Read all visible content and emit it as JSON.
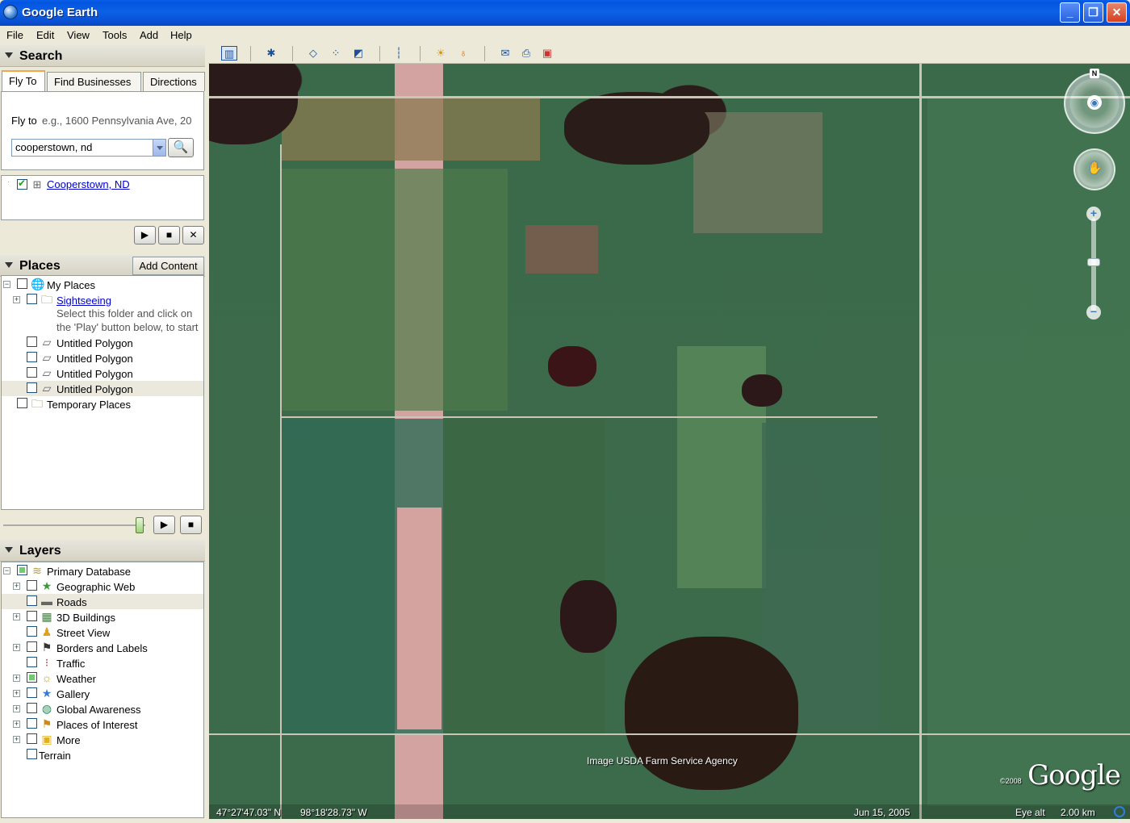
{
  "window": {
    "title": "Google Earth",
    "minimize": "_",
    "maximize": "❐",
    "close": "✕"
  },
  "menu": [
    "File",
    "Edit",
    "View",
    "Tools",
    "Add",
    "Help"
  ],
  "search": {
    "header": "Search",
    "tabs": [
      "Fly To",
      "Find Businesses",
      "Directions"
    ],
    "flyto_label": "Fly to",
    "flyto_hint": "e.g., 1600 Pennsylvania Ave, 20",
    "input_value": "cooperstown, nd",
    "result": "Cooperstown, ND"
  },
  "places": {
    "header": "Places",
    "add_content": "Add Content",
    "items": [
      {
        "label": "My Places"
      },
      {
        "label": "Sightseeing"
      },
      {
        "label": "Select this folder and click on"
      },
      {
        "label": "the 'Play' button below, to start"
      },
      {
        "label": "Untitled Polygon"
      },
      {
        "label": "Untitled Polygon"
      },
      {
        "label": "Untitled Polygon"
      },
      {
        "label": "Untitled Polygon"
      },
      {
        "label": "Temporary Places"
      }
    ]
  },
  "layers": {
    "header": "Layers",
    "items": [
      {
        "label": "Primary Database",
        "icon": "database-icon"
      },
      {
        "label": "Geographic Web",
        "icon": "star-icon"
      },
      {
        "label": "Roads",
        "icon": "road-icon"
      },
      {
        "label": "3D Buildings",
        "icon": "building-icon"
      },
      {
        "label": "Street View",
        "icon": "person-icon"
      },
      {
        "label": "Borders and Labels",
        "icon": "flag-icon"
      },
      {
        "label": "Traffic",
        "icon": "traffic-light-icon"
      },
      {
        "label": "Weather",
        "icon": "sun-icon"
      },
      {
        "label": "Gallery",
        "icon": "star-icon"
      },
      {
        "label": "Global Awareness",
        "icon": "globe-icon"
      },
      {
        "label": "Places of Interest",
        "icon": "flag-icon"
      },
      {
        "label": "More",
        "icon": "folder-icon"
      },
      {
        "label": "Terrain",
        "icon": ""
      }
    ]
  },
  "map": {
    "attribution": "Image USDA Farm Service Agency",
    "logo": "Google",
    "copyright": "©2008",
    "latitude": "47°27'47.03\" N",
    "longitude": "98°18'28.73\" W",
    "date": "Jun 15, 2005",
    "eye_alt_label": "Eye alt",
    "eye_alt_value": "2.00 km",
    "north": "N"
  }
}
